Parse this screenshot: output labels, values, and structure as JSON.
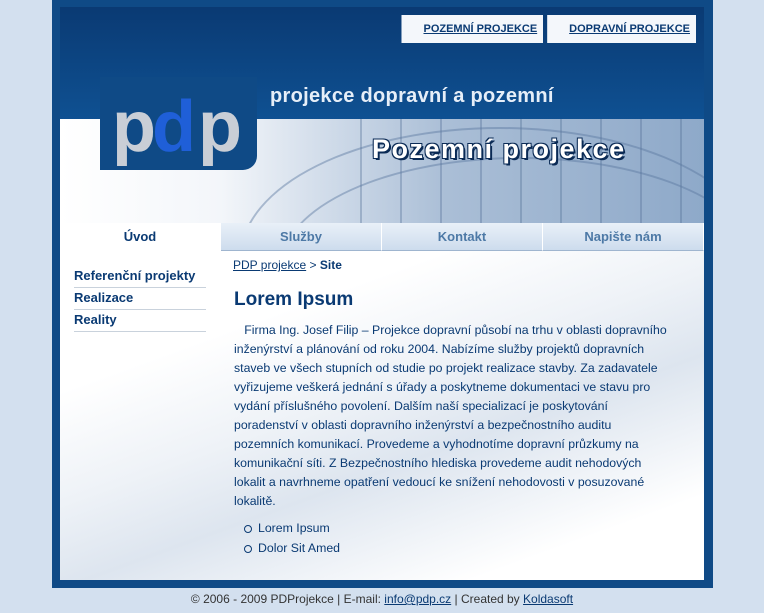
{
  "header": {
    "top_links": [
      "POZEMNÍ PROJEKCE",
      "DOPRAVNÍ PROJEKCE"
    ],
    "logo_text": "pdp",
    "tagline": "projekce dopravní a pozemní",
    "section_title": "Pozemní projekce"
  },
  "nav": {
    "items": [
      "Úvod",
      "Služby",
      "Kontakt",
      "Napište nám"
    ]
  },
  "sidebar": {
    "items": [
      "Referenční projekty",
      "Realizace",
      "Reality"
    ]
  },
  "breadcrumb": {
    "home": "PDP projekce",
    "separator": ">",
    "current": "Site"
  },
  "content": {
    "title": "Lorem Ipsum",
    "text": "Firma Ing. Josef Filip – Projekce dopravní působí na trhu v oblasti dopravního inženýrství a plánování od roku 2004. Nabízíme služby projektů dopravních staveb ve všech stupních od studie po projekt realizace stavby. Za zadavatele vyřizujeme veškerá jednání s úřady a poskytneme dokumentaci ve stavu pro vydání příslušného povolení. Dalším naší specializací je poskytování poradenství v oblasti dopravního inženýrství a bezpečnostního auditu pozemních komunikací. Provedeme a vyhodnotíme dopravní průzkumy na komunikační síti. Z Bezpečnostního hlediska provedeme audit nehodových lokalit a navrhneme opatření vedoucí ke snížení nehodovosti v posuzované lokalitě.",
    "list": [
      "Lorem Ipsum",
      "Dolor Sit Amed"
    ]
  },
  "footer": {
    "copyright": "© 2006 - 2009 PDProjekce | E-mail:",
    "email": "info@pdp.cz",
    "created_by": "| Created by",
    "author": "Koldasoft"
  },
  "colors": {
    "brand_dark": "#0f4a86",
    "text_blue": "#0a3a73",
    "background": "#d3e0ef"
  }
}
